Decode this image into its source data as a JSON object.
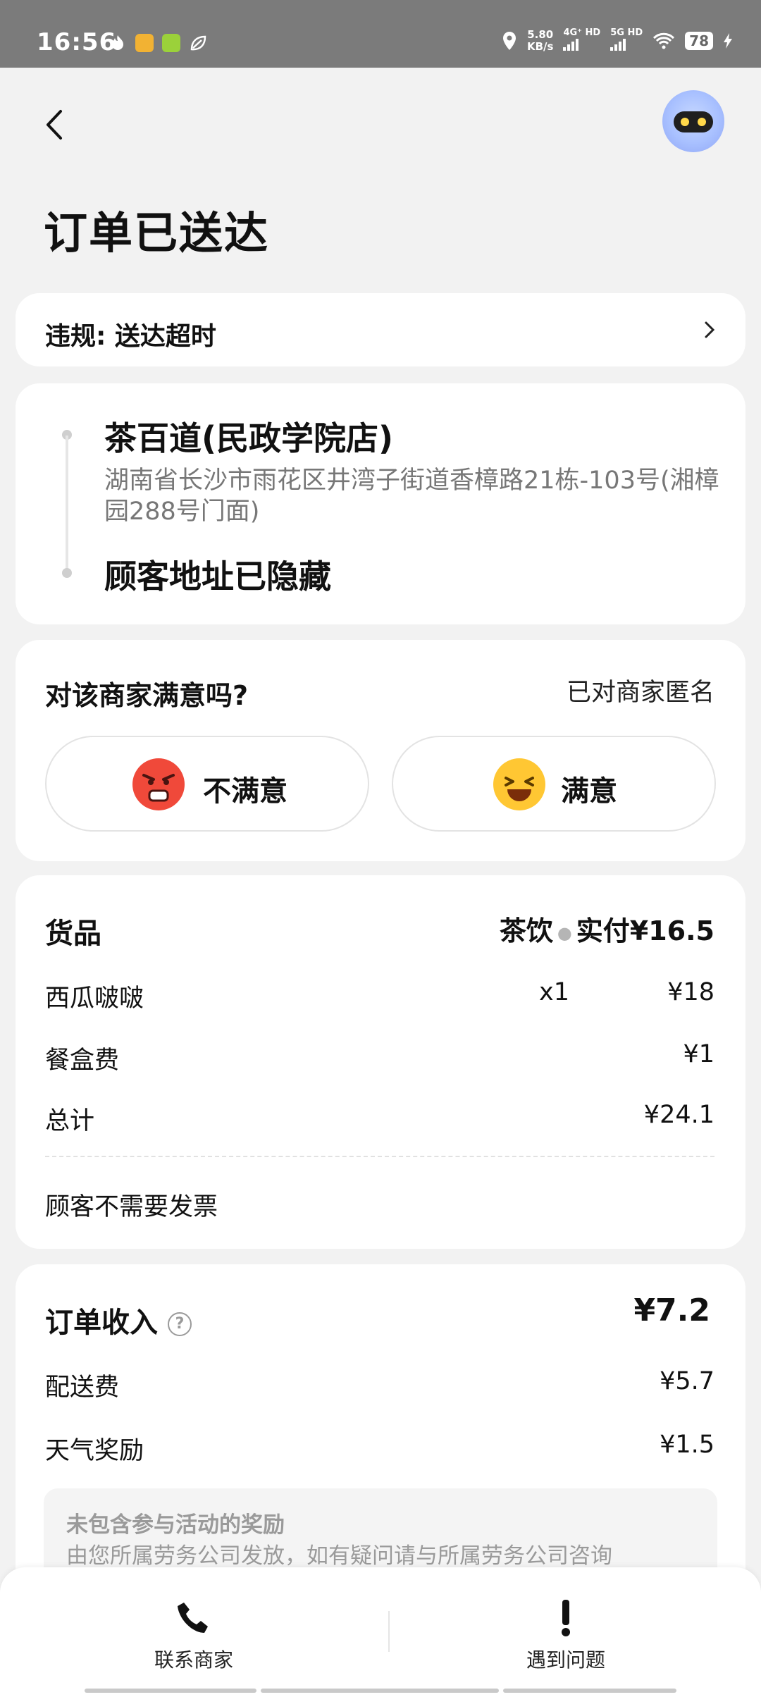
{
  "status_bar": {
    "time": "16:56",
    "net_speed_value": "5.80",
    "net_speed_unit": "KB/s",
    "sim1": "4G⁺ HD",
    "sim2": "5G HD",
    "battery": "78",
    "notification_icons": [
      "fire-icon",
      "app-icon-orange",
      "app-icon-green",
      "leaf-icon"
    ]
  },
  "header": {
    "title": "订单已送达",
    "back_icon": "chevron-left-icon",
    "assistant_icon": "robot-assistant-icon"
  },
  "violation": {
    "text": "违规: 送达超时",
    "icon": "chevron-right-icon"
  },
  "route": {
    "store_name": "茶百道(民政学院店)",
    "store_address": "湖南省长沙市雨花区井湾子街道香樟路21栋-103号(湘樟园288号门面)",
    "customer_address": "顾客地址已隐藏"
  },
  "satisfaction": {
    "question": "对该商家满意吗?",
    "anonymous_note": "已对商家匿名",
    "dissatisfied_label": "不满意",
    "satisfied_label": "满意",
    "dissatisfied_icon": "angry-face-icon",
    "satisfied_icon": "laughing-face-icon"
  },
  "goods": {
    "heading": "货品",
    "category": "茶饮",
    "paid": "实付¥16.5",
    "items": [
      {
        "name": "西瓜啵啵",
        "qty": "x1",
        "price": "¥18"
      }
    ],
    "packaging": {
      "label": "餐盒费",
      "price": "¥1"
    },
    "total": {
      "label": "总计",
      "price": "¥24.1"
    },
    "invoice_note": "顾客不需要发票"
  },
  "income": {
    "heading": "订单收入",
    "help_icon": "question-circle-icon",
    "total": "¥7.2",
    "rows": [
      {
        "label": "配送费",
        "price": "¥5.7"
      },
      {
        "label": "天气奖励",
        "price": "¥1.5"
      }
    ],
    "note_title": "未包含参与活动的奖励",
    "note_body": "由您所属劳务公司发放，如有疑问请与所属劳务公司咨询"
  },
  "bottom_bar": {
    "contact_label": "联系商家",
    "contact_icon": "phone-icon",
    "problem_label": "遇到问题",
    "problem_icon": "exclamation-icon"
  },
  "colors": {
    "page_bg": "#f2f2f2",
    "status_bar_bg": "#7b7b7b",
    "card_bg": "#ffffff",
    "muted_text": "#777777"
  }
}
